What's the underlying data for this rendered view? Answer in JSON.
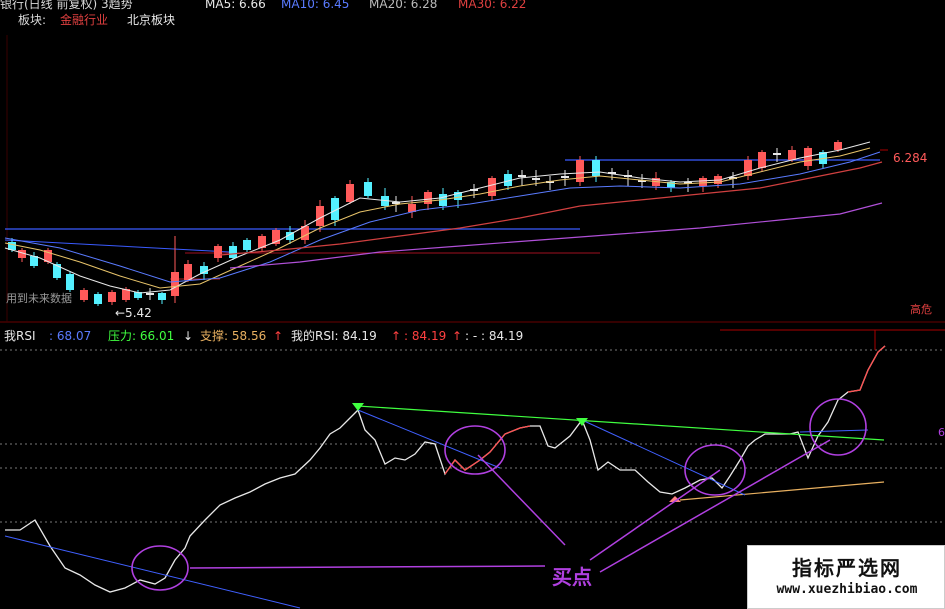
{
  "header": {
    "title": "银行(日线 前复权) 3趋势",
    "ma5": "MA5: 6.66",
    "ma10": "MA10: 6.45",
    "ma20": "MA20: 6.28",
    "ma30": "MA30: 6.22"
  },
  "sector": {
    "label": "板块:",
    "tag1": "金融行业",
    "tag2": "北京板块"
  },
  "price_chart": {
    "last_price": "6.284",
    "low_label": "←5.42",
    "future_note": "用到未来数据",
    "high_label": "高危"
  },
  "rsi_header": {
    "rsi_label": "我RSI",
    "rsi_value": ": 68.07",
    "pressure": "压力: 66.01",
    "pressure_arrow": "↓",
    "support": "支撑: 58.56",
    "support_arrow": "↑",
    "my_rsi": "我的RSI: 84.19",
    "my_rsi_arrow": "↑",
    "val2": ": 84.19",
    "val2_arrow": "↑",
    "val3": ": - : 84.19"
  },
  "annotation": {
    "buy_point": "买点",
    "right_edge": "6"
  },
  "watermark": {
    "main": "指标严选网",
    "sub": "www.xuezhibiao.com"
  },
  "colors": {
    "up": "#ff5a5a",
    "down": "#54f0ff",
    "ma5": "#e8e8e8",
    "ma10": "#e8c46a",
    "ma20": "#5a7bff",
    "ma30": "#d04040",
    "ma60": "#b050d8",
    "rsi": "#e8e8e8",
    "pressure": "#40ff40",
    "support": "#e8b060",
    "circle": "#b040e0"
  }
}
